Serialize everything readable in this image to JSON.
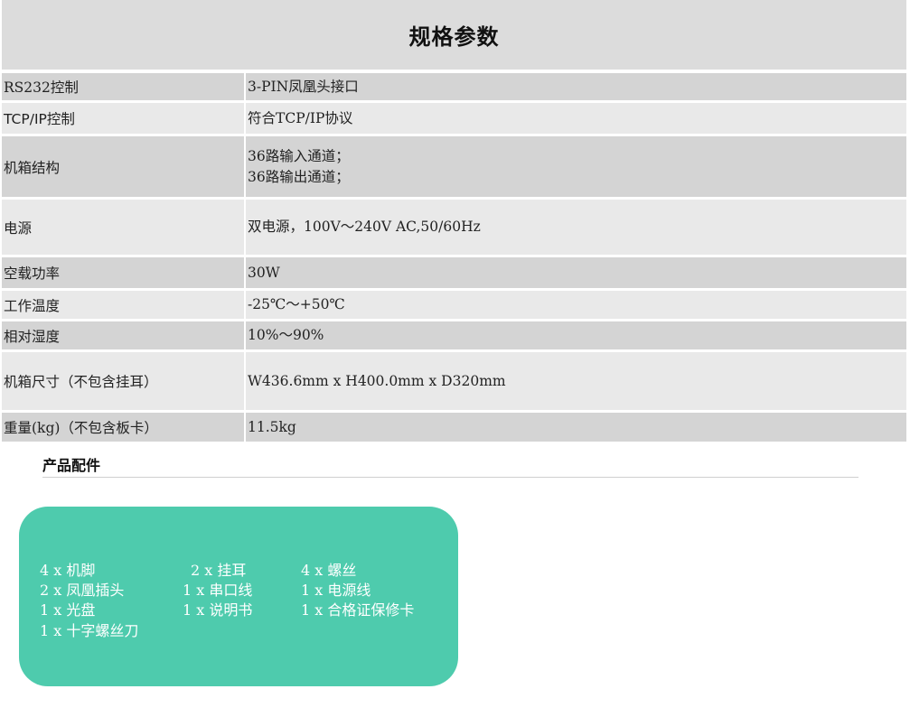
{
  "header": {
    "title": "规格参数"
  },
  "specs": [
    {
      "label": "RS232控制",
      "values": [
        "3-PIN凤凰头接口"
      ]
    },
    {
      "label": "TCP/IP控制",
      "values": [
        "符合TCP/IP协议"
      ]
    },
    {
      "label": "机箱结构",
      "values": [
        "36路输入通道；",
        "36路输出通道；"
      ]
    },
    {
      "label": "电源",
      "values": [
        "双电源，100V～240V AC,50/60Hz"
      ]
    },
    {
      "label": "空载功率",
      "values": [
        "30W"
      ]
    },
    {
      "label": "工作温度",
      "values": [
        "-25℃～+50℃"
      ]
    },
    {
      "label": "相对湿度",
      "values": [
        "10%～90%"
      ]
    },
    {
      "label": "机箱尺寸（不包含挂耳）",
      "values": [
        "W436.6mm x H400.0mm x D320mm"
      ]
    },
    {
      "label": "重量(kg)（不包含板卡）",
      "values": [
        "11.5kg"
      ]
    }
  ],
  "accessories": {
    "heading": "产品配件",
    "items": [
      "4 x 机脚",
      "2 x 挂耳",
      "4 x 螺丝",
      "2 x 凤凰插头",
      "1 x 串口线",
      "1 x 电源线",
      "1 x 光盘",
      "1 x 说明书",
      "1 x 合格证保修卡",
      "1 x 十字螺丝刀"
    ]
  }
}
